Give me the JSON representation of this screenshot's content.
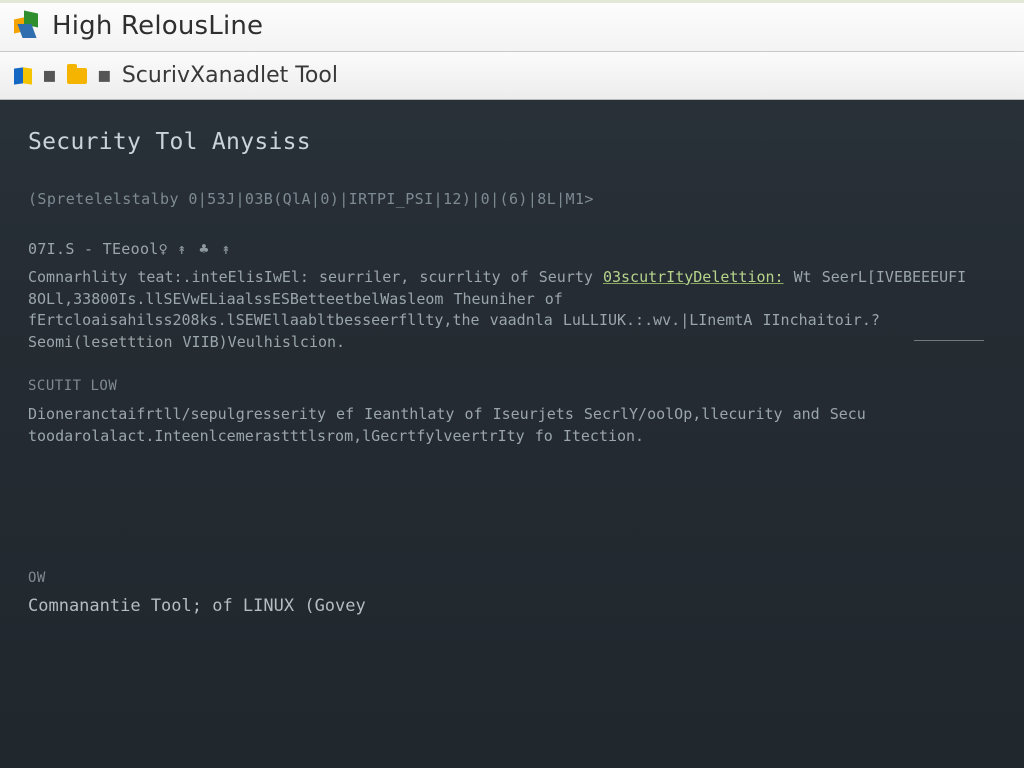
{
  "window": {
    "title": "High RelousLine"
  },
  "toolbar": {
    "crumb_label": "ScurivXanadlet Tool"
  },
  "content": {
    "heading": "Security Tol Anysiss",
    "meta_line": "(Spretelelstalby 0|53J|03B(QlA|0)|IRTPI_PSI|12)|0|(6)|8L|M1>",
    "sub1": "07I.S - TEeool♀ ",
    "sub1_arrows": "↟ ♣ ↟",
    "para1_a": "Comnarhlity teat:.inteElisIwEl: seurriler, scurrlity of Seurty ",
    "para1_hl": "03scutrItyDelettion:",
    "para1_b": "  Wt SeerL[IVEBEEEUFI 8OLl,33800Is.llSEVwELiaalssESBetteetbelWasleom Theuniher of fErtcloaisahilss208ks.lSEWEllaabltbesseerfllty,the vaadnla   LuLLIUK.:.wv.|LInemtA IInchaitoir.?Seomi(lesetttion VIIB)Veulhislcion.",
    "section2_label": "scutit low",
    "para2": "Dioneranctaifrtll/sepulgresserity ef Ieanthlaty of Iseurjets SecrlY/oolOp,llecurity and Secu toodarolalact.Inteenlcemerastttlsrom,lGecrtfylveertrIty fo Itection.",
    "footer_label": "ow",
    "footer_line": "Comnanantie Tool; of LINUX (Govey"
  }
}
